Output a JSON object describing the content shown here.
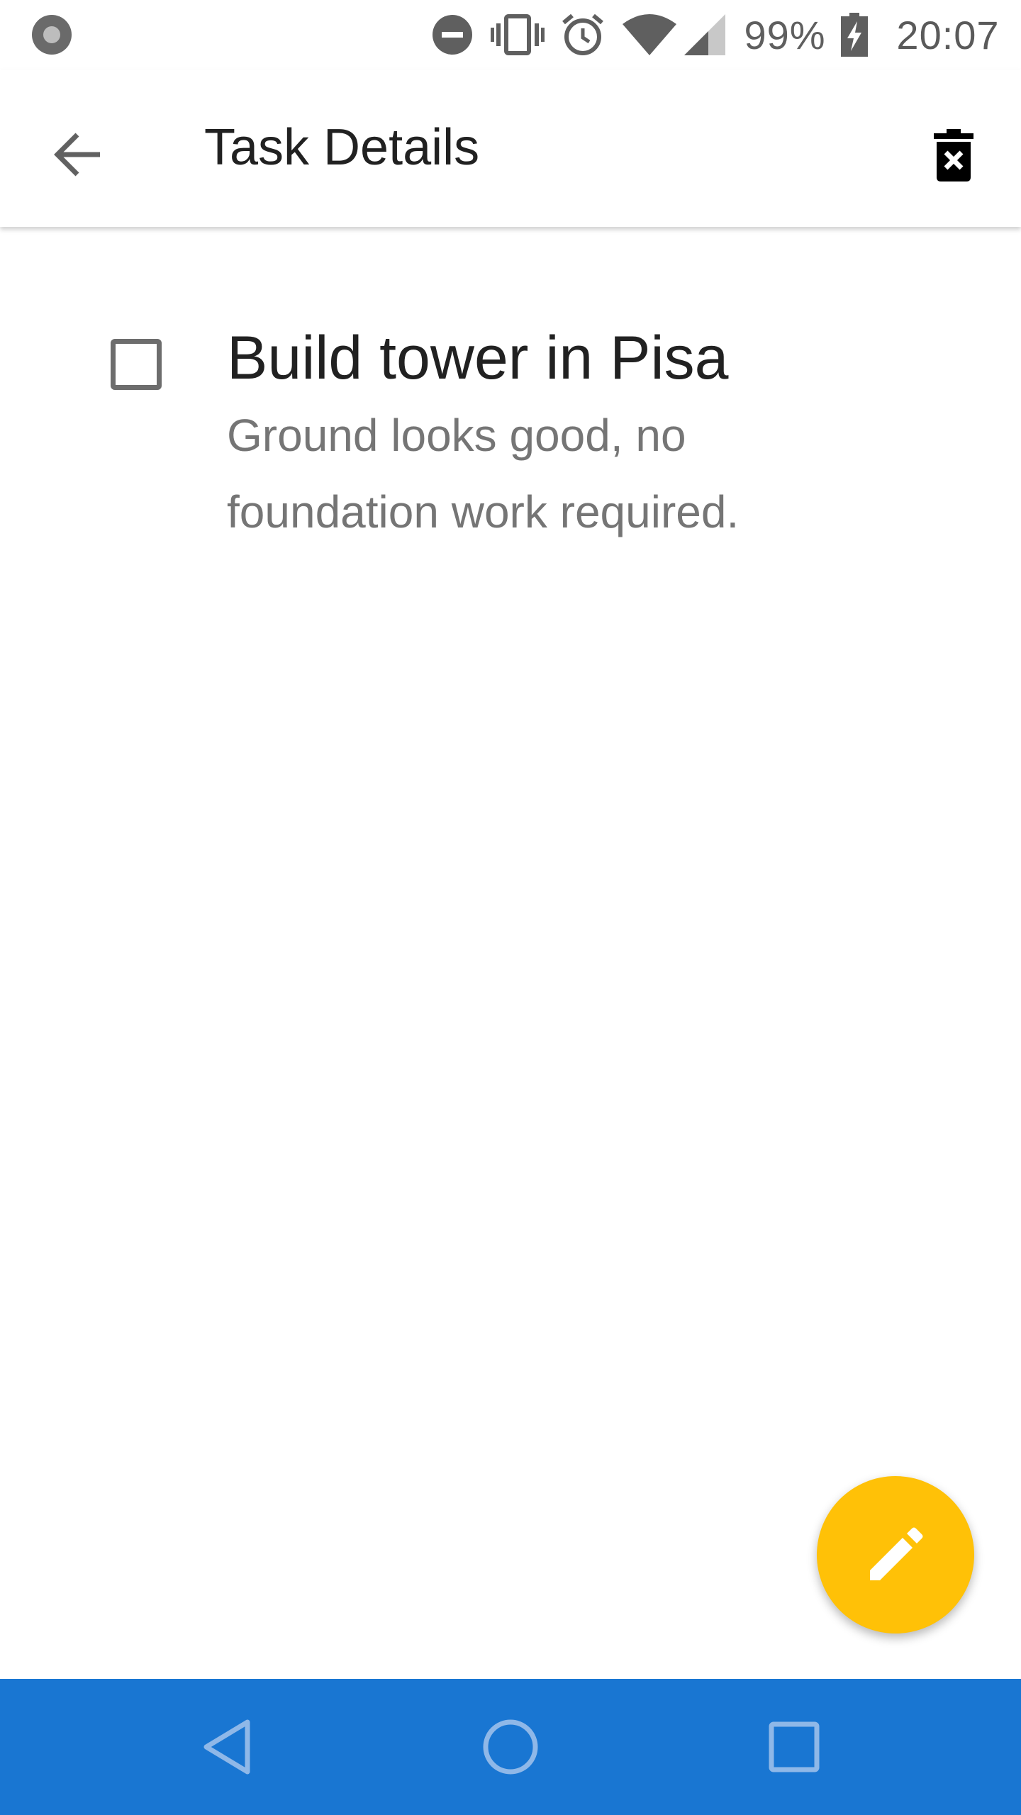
{
  "status_bar": {
    "battery_percent": "99%",
    "time": "20:07",
    "icons": [
      "record-icon",
      "do-not-disturb-icon",
      "vibrate-icon",
      "alarm-icon",
      "wifi-icon",
      "cellular-signal-icon",
      "battery-charging-icon"
    ]
  },
  "app_bar": {
    "title": "Task Details",
    "back_icon": "arrow-back-icon",
    "delete_icon": "delete-forever-icon"
  },
  "task": {
    "title": "Build tower in Pisa",
    "description": "Ground looks good, no foundation work required.",
    "completed": false
  },
  "fab": {
    "icon": "edit-icon",
    "color": "#ffc107"
  },
  "nav_bar": {
    "color": "#1976d2",
    "buttons": [
      "nav-back-icon",
      "nav-home-icon",
      "nav-recents-icon"
    ]
  }
}
